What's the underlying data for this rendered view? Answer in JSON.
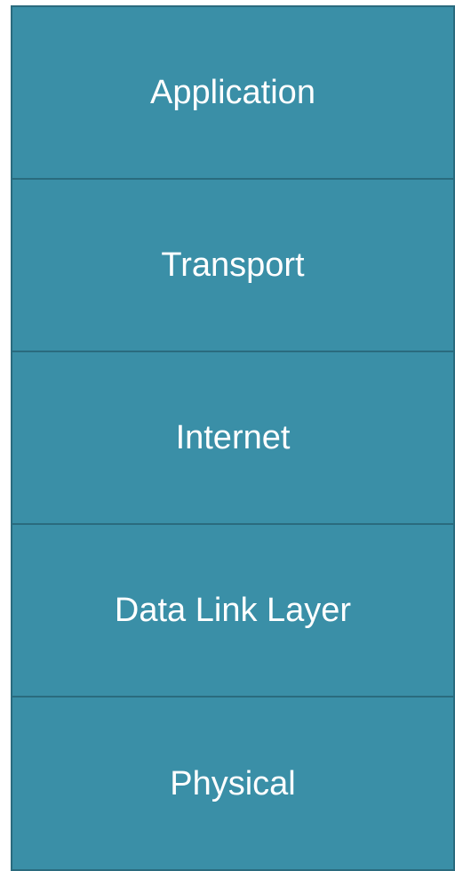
{
  "colors": {
    "layer_fill": "#3a8fa7",
    "layer_border": "#2a6b7e",
    "label_text": "#ffffff"
  },
  "layers": [
    {
      "label": "Application"
    },
    {
      "label": "Transport"
    },
    {
      "label": "Internet"
    },
    {
      "label": "Data Link Layer"
    },
    {
      "label": "Physical"
    }
  ]
}
